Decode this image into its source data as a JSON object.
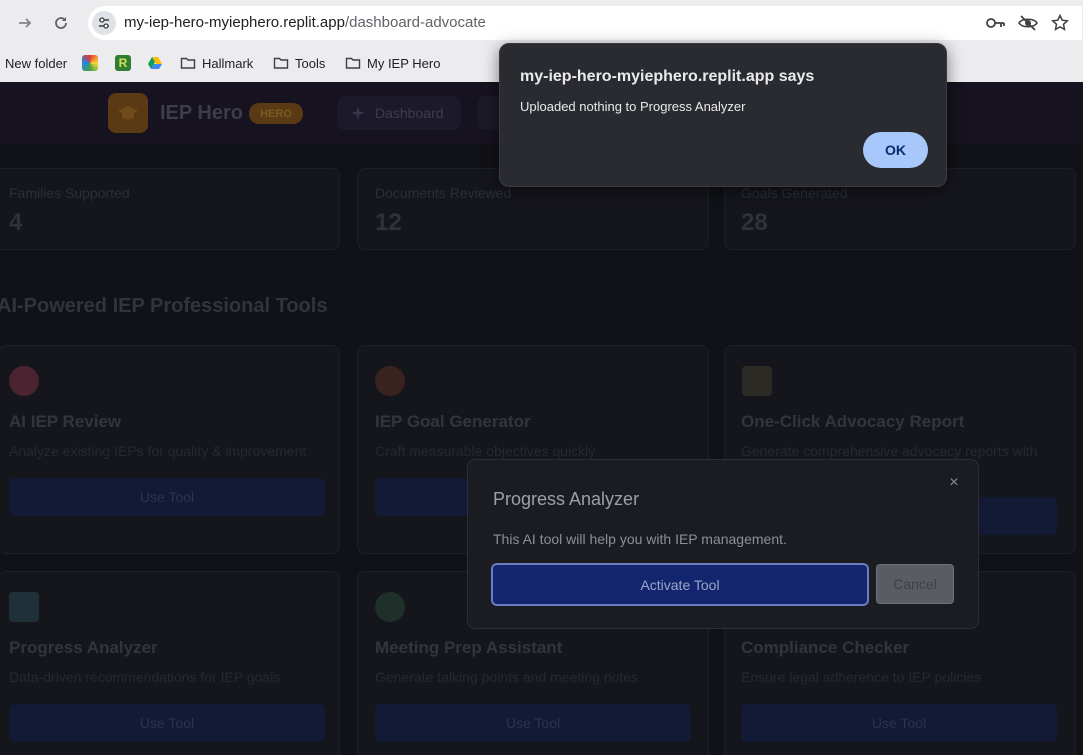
{
  "browser": {
    "url_host": "my-iep-hero-myiephero.replit.app",
    "url_path": "/dashboard-advocate",
    "icons": [
      "forward-icon",
      "reload-icon",
      "site-settings-icon",
      "password-key-icon",
      "tracking-off-icon",
      "bookmark-star-icon"
    ]
  },
  "bookmarks": [
    {
      "label": "New folder",
      "icon": "none"
    },
    {
      "label": "",
      "icon": "rainbow-favicon"
    },
    {
      "label": "",
      "icon": "r-favicon"
    },
    {
      "label": "",
      "icon": "drive-favicon"
    },
    {
      "label": "Hallmark",
      "icon": "folder-icon"
    },
    {
      "label": "Tools",
      "icon": "folder-icon"
    },
    {
      "label": "My IEP Hero",
      "icon": "folder-icon"
    }
  ],
  "app": {
    "brand": "IEP Hero",
    "badge": "HERO",
    "nav_dashboard": "Dashboard"
  },
  "stats": [
    {
      "label": "Families Supported",
      "value": "4"
    },
    {
      "label": "Documents Reviewed",
      "value": "12"
    },
    {
      "label": "Goals Generated",
      "value": "28"
    }
  ],
  "section_title": "AI-Powered IEP Professional Tools",
  "tools": [
    {
      "title": "AI IEP Review",
      "desc": "Analyze existing IEPs for quality & improvement",
      "button": "Use Tool",
      "icon": "brain-icon",
      "color": "#4a2430"
    },
    {
      "title": "IEP Goal Generator",
      "desc": "Craft measurable objectives quickly",
      "button": "Use Tool",
      "icon": "target-icon",
      "color": "#3a2220"
    },
    {
      "title": "One-Click Advocacy Report",
      "desc": "Generate comprehensive advocacy reports with",
      "button": "Use Tool",
      "icon": "clipboard-icon",
      "color": "#2b2a24"
    },
    {
      "title": "Progress Analyzer",
      "desc": "Data-driven recommendations for IEP goals",
      "button": "Use Tool",
      "icon": "bar-chart-icon",
      "color": "#203038"
    },
    {
      "title": "Meeting Prep Assistant",
      "desc": "Generate talking points and meeting notes",
      "button": "Use Tool",
      "icon": "speech-icon",
      "color": "#1f2f2a"
    },
    {
      "title": "Compliance Checker",
      "desc": "Ensure legal adherence to IEP policies",
      "button": "Use Tool",
      "icon": "",
      "color": "#15161c"
    }
  ],
  "alert": {
    "title": "my-iep-hero-myiephero.replit.app says",
    "message": "Uploaded nothing to Progress Analyzer",
    "ok": "OK"
  },
  "modal": {
    "title": "Progress Analyzer",
    "close": "×",
    "description": "This AI tool will help you with IEP management.",
    "activate": "Activate Tool",
    "cancel": "Cancel"
  }
}
